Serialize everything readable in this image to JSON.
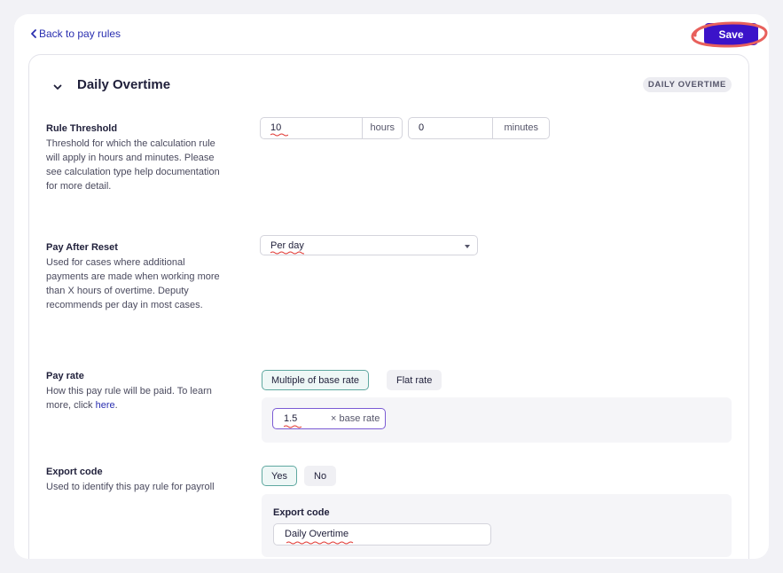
{
  "nav": {
    "back_label": "Back to pay rules"
  },
  "toolbar": {
    "save_label": "Save"
  },
  "section": {
    "title": "Daily Overtime",
    "type_badge": "DAILY OVERTIME"
  },
  "rule_threshold": {
    "title": "Rule Threshold",
    "description": "Threshold for which the calculation rule will apply in hours and minutes. Please see calculation type help documentation for more detail.",
    "hours_value": "10",
    "hours_suffix": "hours",
    "minutes_value": "0",
    "minutes_suffix": "minutes"
  },
  "pay_after_reset": {
    "title": "Pay After Reset",
    "description": "Used for cases where additional payments are made when working more than X hours of overtime. Deputy recommends per day in most cases.",
    "selected": "Per day"
  },
  "pay_rate": {
    "title": "Pay rate",
    "description_prefix": "How this pay rule will be paid. To learn more, click ",
    "description_link": "here",
    "description_suffix": ".",
    "options": [
      "Multiple of base rate",
      "Flat rate"
    ],
    "active_option": "Multiple of base rate",
    "multiplier_value": "1.5",
    "multiplier_suffix": "× base rate"
  },
  "export_code": {
    "title": "Export code",
    "description": "Used to identify this pay rule for payroll",
    "options": [
      "Yes",
      "No"
    ],
    "active_option": "Yes",
    "field_label": "Export code",
    "field_value": "Daily Overtime"
  },
  "colors": {
    "page_bg": "#f2f2f6",
    "primary": "#3b13c9",
    "link": "#2a2fb0",
    "active_toggle_border": "#5fa8a0",
    "annotation_ring": "#e8605c",
    "spellcheck": "#e0332e"
  },
  "icons": {
    "back": "chevron-left-icon",
    "collapse": "chevron-down-icon",
    "select": "caret-down-icon"
  }
}
